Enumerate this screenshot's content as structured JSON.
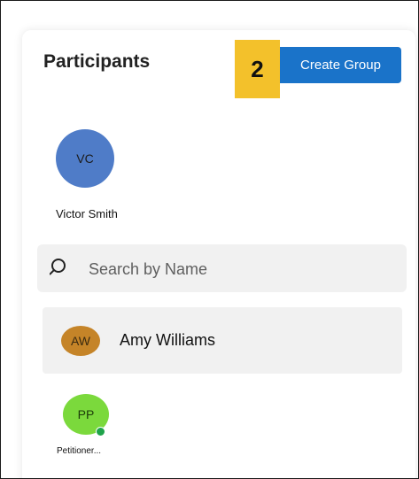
{
  "header": {
    "title": "Participants",
    "step_number": "2",
    "create_group_label": "Create Group"
  },
  "current_user": {
    "initials": "VC",
    "name": "Victor Smith",
    "avatar_color": "#4f7cc8"
  },
  "search": {
    "placeholder": "Search by Name",
    "value": ""
  },
  "participants": [
    {
      "initials": "AW",
      "name": "Amy Williams",
      "avatar_color": "#c58428"
    },
    {
      "initials": "PP",
      "name": "Petitioner...",
      "avatar_color": "#7bd93c",
      "online": true
    }
  ],
  "colors": {
    "accent": "#1a73c9",
    "step_badge": "#f3c12b",
    "online": "#1fa34a"
  },
  "icons": {
    "search": "search-icon",
    "status": "online-status-icon"
  }
}
